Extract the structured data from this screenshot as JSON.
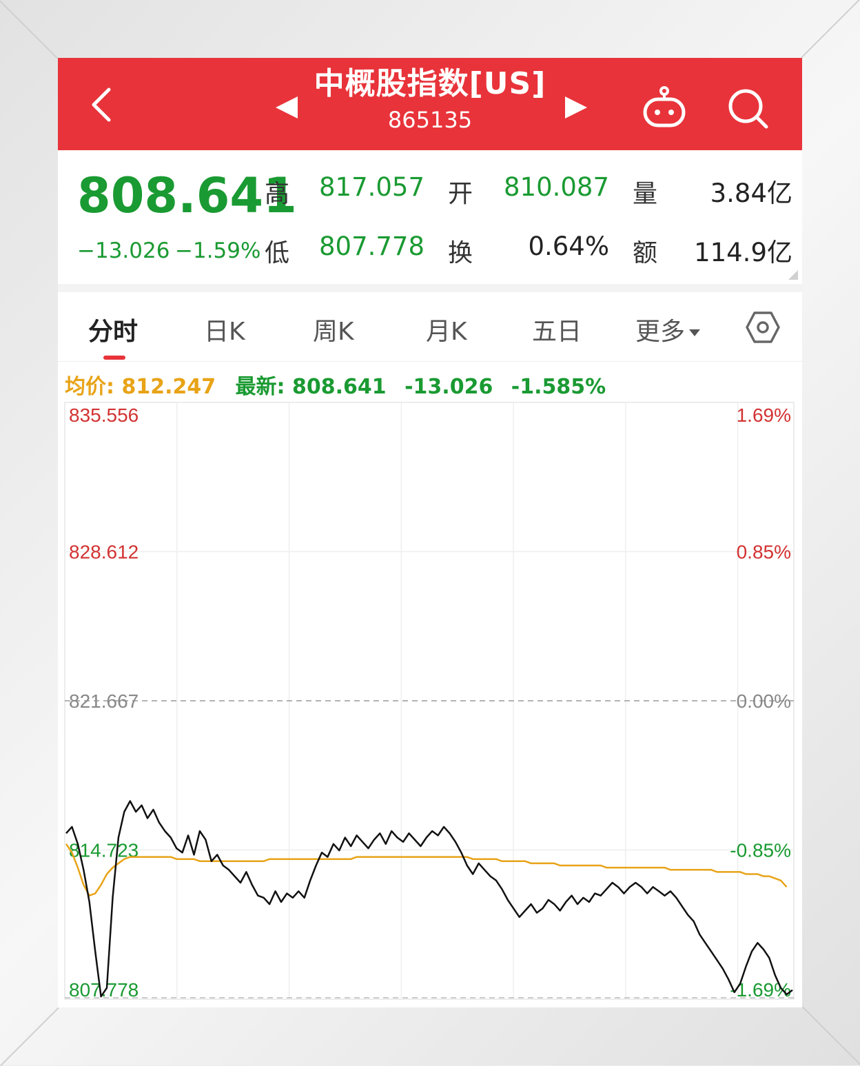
{
  "header": {
    "title": "中概股指数[US]",
    "code": "865135"
  },
  "quote": {
    "price": "808.641",
    "change": "−13.026",
    "change_pct": "−1.59%",
    "high_label": "高",
    "high_value": "817.057",
    "open_label": "开",
    "open_value": "810.087",
    "volume_label": "量",
    "volume_value": "3.84亿",
    "low_label": "低",
    "low_value": "807.778",
    "turnover_label": "换",
    "turnover_value": "0.64%",
    "amount_label": "额",
    "amount_value": "114.9亿"
  },
  "tabs": [
    {
      "label": "分时"
    },
    {
      "label": "日K"
    },
    {
      "label": "周K"
    },
    {
      "label": "月K"
    },
    {
      "label": "五日"
    },
    {
      "label": "更多"
    }
  ],
  "info": {
    "avg_label": "均价: 812.247",
    "latest_label": "最新: 808.641",
    "latest_change": "-13.026",
    "latest_pct": "-1.585%"
  },
  "colors": {
    "header_bg": "#e8333a",
    "up": "#d33232",
    "down": "#1a9a32",
    "avg_line": "#e8a317",
    "price_line": "#111111"
  },
  "chart_data": {
    "type": "line",
    "ylim": [
      807.778,
      835.556
    ],
    "ylabels_left": [
      "835.556",
      "828.612",
      "821.667",
      "814.723",
      "807.778"
    ],
    "ylabels_right": [
      "1.69%",
      "0.85%",
      "0.00%",
      "-0.85%",
      "-1.69%"
    ],
    "reference": 821.667,
    "series": [
      {
        "values": [
          815.5,
          815.8,
          815.0,
          813.8,
          812.3,
          810.0,
          807.9,
          808.3,
          812.5,
          815.3,
          816.5,
          817.0,
          816.5,
          816.8,
          816.2,
          816.6,
          816.0,
          815.6,
          815.3,
          814.8,
          814.6,
          815.4,
          814.5,
          815.6,
          815.2,
          814.2,
          814.5,
          814.0,
          813.8,
          813.5,
          813.2,
          813.7,
          813.1,
          812.6,
          812.5,
          812.2,
          812.8,
          812.3,
          812.7,
          812.5,
          812.8,
          812.5,
          813.3,
          814.0,
          814.6,
          814.4,
          815.0,
          814.7,
          815.3,
          814.9,
          815.4,
          815.1,
          814.8,
          815.2,
          815.5,
          815.0,
          815.6,
          815.3,
          815.1,
          815.5,
          815.2,
          814.9,
          815.3,
          815.6,
          815.4,
          815.8,
          815.5,
          815.1,
          814.6,
          814.0,
          813.6,
          814.1,
          813.8,
          813.5,
          813.3,
          812.9,
          812.4,
          812.0,
          811.6,
          811.9,
          812.2,
          811.8,
          812.0,
          812.4,
          812.2,
          811.9,
          812.3,
          812.6,
          812.2,
          812.5,
          812.3,
          812.7,
          812.6,
          812.9,
          813.2,
          813.0,
          812.7,
          813.0,
          813.2,
          813.0,
          812.7,
          813.0,
          812.8,
          812.6,
          812.8,
          812.5,
          812.1,
          811.7,
          811.4,
          810.8,
          810.4,
          810.0,
          809.6,
          809.2,
          808.7,
          808.1,
          808.5,
          809.3,
          810.0,
          810.4,
          810.1,
          809.7,
          808.9,
          808.3,
          808.0,
          808.2
        ],
        "avg": [
          815.0,
          814.6,
          813.9,
          813.1,
          812.6,
          812.7,
          813.1,
          813.6,
          813.9,
          814.1,
          814.3,
          814.4,
          814.4,
          814.4,
          814.4,
          814.4,
          814.4,
          814.4,
          814.4,
          814.3,
          814.3,
          814.3,
          814.3,
          814.2,
          814.2,
          814.2,
          814.2,
          814.2,
          814.2,
          814.2,
          814.2,
          814.2,
          814.2,
          814.2,
          814.2,
          814.3,
          814.3,
          814.3,
          814.3,
          814.3,
          814.3,
          814.3,
          814.3,
          814.3,
          814.3,
          814.3,
          814.3,
          814.3,
          814.3,
          814.3,
          814.4,
          814.4,
          814.4,
          814.4,
          814.4,
          814.4,
          814.4,
          814.4,
          814.4,
          814.4,
          814.4,
          814.4,
          814.4,
          814.4,
          814.4,
          814.4,
          814.4,
          814.4,
          814.4,
          814.4,
          814.3,
          814.3,
          814.3,
          814.3,
          814.3,
          814.2,
          814.2,
          814.2,
          814.2,
          814.2,
          814.1,
          814.1,
          814.1,
          814.1,
          814.1,
          814.0,
          814.0,
          814.0,
          814.0,
          814.0,
          814.0,
          814.0,
          814.0,
          813.9,
          813.9,
          813.9,
          813.9,
          813.9,
          813.9,
          813.9,
          813.9,
          813.9,
          813.9,
          813.9,
          813.8,
          813.8,
          813.8,
          813.8,
          813.8,
          813.8,
          813.8,
          813.8,
          813.7,
          813.7,
          813.7,
          813.7,
          813.7,
          813.6,
          813.6,
          813.6,
          813.5,
          813.5,
          813.4,
          813.3,
          813.0
        ]
      }
    ]
  }
}
